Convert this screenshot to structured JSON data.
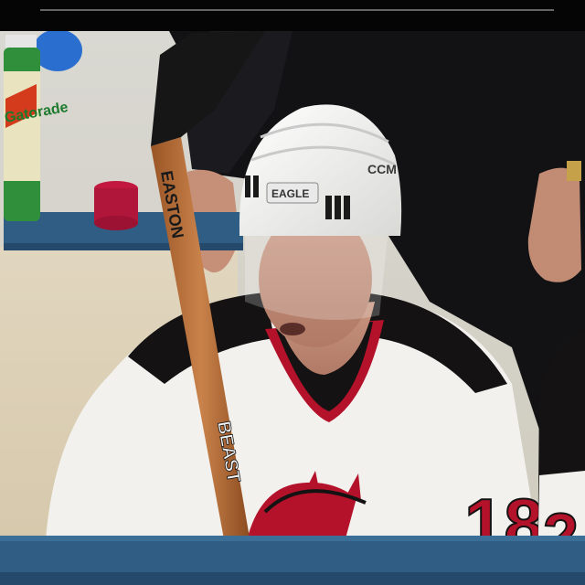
{
  "scene": {
    "bottle_brand": "Gatorade",
    "stick_brand_upper": "EASTON",
    "stick_brand_lower": "BEAST",
    "helmet_brand": "CCM",
    "helmet_label": "EAGLE",
    "jersey_number": "18",
    "adjacent_jersey_number_partial": "2"
  },
  "colors": {
    "jersey_white": "#f2f1ee",
    "jersey_black": "#141212",
    "devils_red": "#b3122a",
    "bench_blue": "#2f5d84",
    "stick_wood": "#b06a35",
    "gatorade_green": "#2f8f3a"
  }
}
